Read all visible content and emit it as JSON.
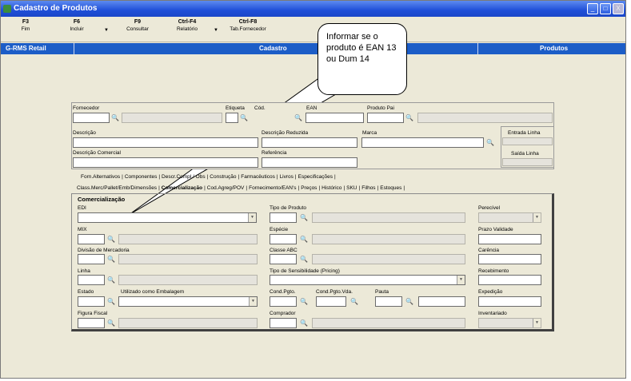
{
  "window": {
    "title": "Cadastro de Produtos",
    "controls": [
      "_",
      "□",
      "X"
    ]
  },
  "toolbar": {
    "items": [
      {
        "key": "F3",
        "label": "Fim"
      },
      {
        "key": "F6",
        "label": "Incluir"
      },
      {
        "key": "F9",
        "label": "Consultar"
      },
      {
        "key": "Ctrl-F4",
        "label": "Relatório"
      },
      {
        "key": "Ctrl-F8",
        "label": "Tab.Fornecedor"
      }
    ],
    "dropdown_glyph": "▼"
  },
  "header_bar": {
    "left": "G-RMS Retail",
    "center": "Cadastro",
    "right": "Produtos"
  },
  "callout": {
    "text": "Informar se o produto é EAN 13 ou Dum 14"
  },
  "top_form": {
    "fornecedor": "Fornecedor",
    "etiqueta": "Etiqueta",
    "codigo": "Cód.",
    "ean": "EAN",
    "produto_pai": "Produto Pai",
    "descricao": "Descrição",
    "descricao_reduzida": "Descrição Reduzida",
    "marca": "Marca",
    "descricao_comercial": "Descrição Comercial",
    "referencia": "Referência",
    "entrada_linha": "Entrada Linha",
    "saida_linha": "Saída Linha"
  },
  "tabs_row1": [
    "Forn.Alternativos",
    "Componentes",
    "Descr.Compl./ Obs",
    "Construção",
    "Farmacêuticos",
    "Livros",
    "Especificações"
  ],
  "tabs_row2": [
    "Class.Merc/Pallet/Emb/Dimensões",
    "Comercialização",
    "Cod.Agreg/POV",
    "Fornecimento/EAN's",
    "Preços",
    "Histórico",
    "SKU",
    "Filhos",
    "Estoques"
  ],
  "tab_panel": {
    "section_title": "Comercialização",
    "edi": "EDI",
    "tipo_produto": "Tipo de Produto",
    "perecivel": "Perecível",
    "mix": "MIX",
    "especie": "Espécie",
    "prazo_validade": "Prazo Validade",
    "divisao_mercadoria": "Divisão de Mercadoria",
    "classe_abc": "Classe ABC",
    "carencia": "Carência",
    "linha": "Linha",
    "tipo_sensibilidade": "Tipo de Sensibilidade (Pricing)",
    "recebimento": "Recebimento",
    "estado": "Estado",
    "utilizado_embalagem": "Utilizado como Embalagem",
    "cond_pgto": "Cond.Pgto.",
    "cond_pgto_vda": "Cond.Pgto.Vda.",
    "pauta": "Pauta",
    "expedicao": "Expedição",
    "figura_fiscal": "Figura Fiscal",
    "comprador": "Comprador",
    "inventariado": "Inventariado"
  },
  "icons": {
    "binoculars": "binoculars-icon"
  }
}
